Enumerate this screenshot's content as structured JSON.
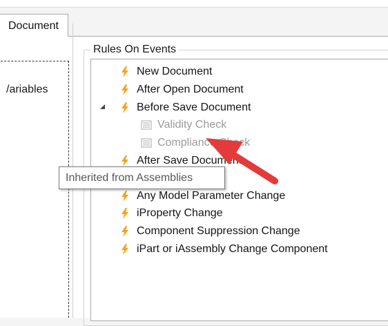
{
  "tab": {
    "label": "Document"
  },
  "left_panel": {
    "item_label": "/ariables"
  },
  "rules_group": {
    "title": "Rules On Events",
    "items": [
      {
        "label": "New Document",
        "type": "event"
      },
      {
        "label": "After Open Document",
        "type": "event"
      },
      {
        "label": "Before Save Document",
        "type": "event",
        "expanded": true
      },
      {
        "label": "Validity Check",
        "type": "rule",
        "inherited": true
      },
      {
        "label": "Compliance Check",
        "type": "rule",
        "inherited": true
      },
      {
        "label": "After Save Document",
        "type": "event"
      },
      {
        "label": "Any Model Parameter Change",
        "type": "event"
      },
      {
        "label": "iProperty Change",
        "type": "event"
      },
      {
        "label": "Component Suppression Change",
        "type": "event"
      },
      {
        "label": "iPart or iAssembly Change Component",
        "type": "event"
      }
    ]
  },
  "tooltip": {
    "text": "Inherited from Assemblies"
  },
  "colors": {
    "bolt": "#f6a21d",
    "arrow": "#e33b3b",
    "inherited_text": "#9a9a9a"
  },
  "icons": {
    "event": "lightning-bolt-icon",
    "rule": "rule-document-icon",
    "expander": "collapse-triangle-icon"
  }
}
